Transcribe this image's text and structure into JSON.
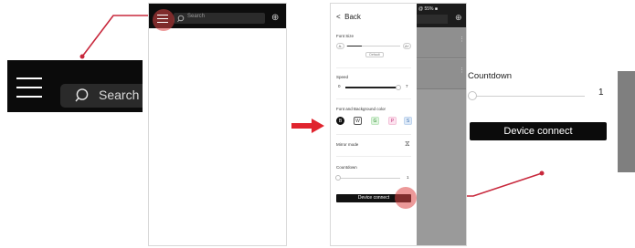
{
  "zoom_left": {
    "search_placeholder": "Search"
  },
  "screen1": {
    "search_placeholder": "Search",
    "add_icon": "plus-circle-icon",
    "menu_icon": "hamburger-menu-icon"
  },
  "screen2": {
    "status": "@ 55% ■",
    "back_label": "Back",
    "font_size": {
      "label": "Font Size",
      "min": "A-",
      "max": "A+",
      "default_label": "Default"
    },
    "speed": {
      "label": "Speed",
      "min": "0",
      "max": "7"
    },
    "color": {
      "label": "Font and Background color",
      "chips": [
        {
          "letter": "B",
          "fg": "#ffffff",
          "bg": "#111111",
          "border": "#111111"
        },
        {
          "letter": "W",
          "fg": "#333333",
          "bg": "#ffffff",
          "border": "#555555"
        },
        {
          "letter": "G",
          "fg": "#2e8b2e",
          "bg": "#dff5df",
          "border": "#bfe5bf"
        },
        {
          "letter": "P",
          "fg": "#c0327a",
          "bg": "#fde3ef",
          "border": "#f3c4da"
        },
        {
          "letter": "S",
          "fg": "#3a6fb0",
          "bg": "#dde9f7",
          "border": "#c0d5ee"
        }
      ]
    },
    "mirror": {
      "label": "Mirror mode"
    },
    "countdown": {
      "label": "Countdown",
      "value": "1"
    },
    "connect_label": "Device connect"
  },
  "zoom_right": {
    "countdown_label": "Countdown",
    "countdown_value": "1",
    "connect_label": "Device connect"
  },
  "colors": {
    "highlight": "#dc4646",
    "callout_line": "#c8283c",
    "arrow": "#e0242e"
  }
}
